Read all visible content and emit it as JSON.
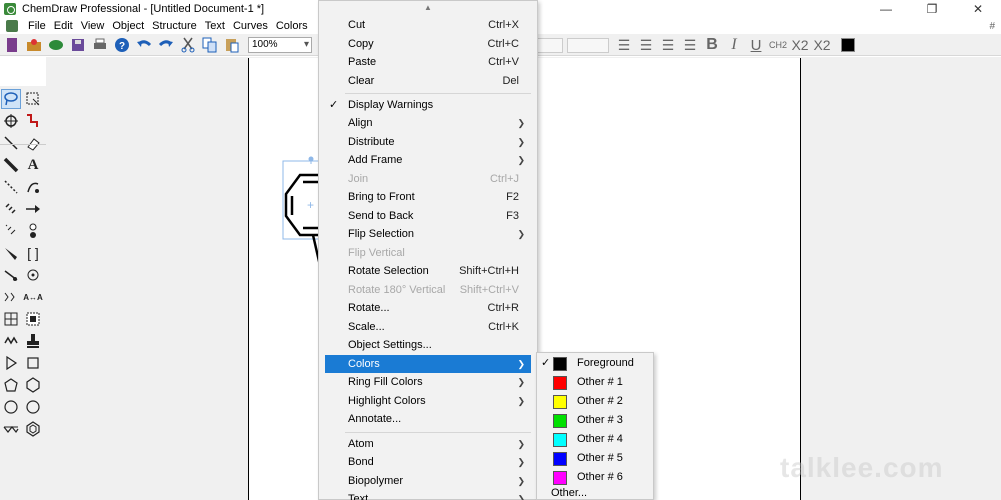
{
  "window": {
    "title": "ChemDraw Professional - [Untitled Document-1 *]",
    "controls": {
      "minimize": "—",
      "maximize": "❐",
      "close": "✕"
    }
  },
  "menubar": {
    "items": [
      "File",
      "Edit",
      "View",
      "Object",
      "Structure",
      "Text",
      "Curves",
      "Colors"
    ],
    "right_marker": "#"
  },
  "toolbar": {
    "zoom_value": "100%",
    "format_buttons": [
      "B",
      "I",
      "U",
      "CH2",
      "X2",
      "X2"
    ],
    "icons": [
      "new-document-icon",
      "open-icon",
      "online-icon",
      "save-icon",
      "print-icon",
      "help-icon",
      "undo-icon",
      "redo-icon",
      "cut-icon",
      "copy-icon",
      "paste-icon"
    ],
    "foreground_color": "#000000"
  },
  "palette": {
    "tools": [
      "lasso-tool",
      "marquee-tool",
      "chain-tool",
      "structure-perspective-tool",
      "solid-bond-tool",
      "eraser-tool",
      "bold-bond-tool",
      "text-tool",
      "dashed-bond-tool",
      "pen-tool",
      "hashed-bond-tool",
      "arrow-tool",
      "hash-wedge-tool",
      "orbital-tool",
      "wedge-bond-tool",
      "bracket-tool",
      "wavy-bond-tool",
      "chemical-symbol-tool",
      "query-tool",
      "atom-map-tool",
      "table-tool",
      "template-tool",
      "ring-tool",
      "stamp-tool",
      "triangle-ring-tool",
      "square-ring-tool",
      "pentagon-ring-tool",
      "hexagon-ring-tool",
      "circle-ring-tool",
      "cyclohexane-tool",
      "wave-ring-tool",
      "benzene-tool"
    ]
  },
  "context_menu": {
    "scroll_up": "▲",
    "items": [
      {
        "label": "Cut",
        "shortcut": "Ctrl+X"
      },
      {
        "label": "Copy",
        "shortcut": "Ctrl+C"
      },
      {
        "label": "Paste",
        "shortcut": "Ctrl+V"
      },
      {
        "label": "Clear",
        "shortcut": "Del"
      },
      {
        "label": "Display Warnings",
        "checked": true
      },
      {
        "label": "Align",
        "submenu": true
      },
      {
        "label": "Distribute",
        "submenu": true
      },
      {
        "label": "Add Frame",
        "submenu": true
      },
      {
        "label": "Join",
        "shortcut": "Ctrl+J",
        "disabled": true
      },
      {
        "label": "Bring to Front",
        "shortcut": "F2"
      },
      {
        "label": "Send to Back",
        "shortcut": "F3"
      },
      {
        "label": "Flip Selection",
        "submenu": true
      },
      {
        "label": "Flip Vertical",
        "disabled": true
      },
      {
        "label": "Rotate Selection",
        "shortcut": "Shift+Ctrl+H"
      },
      {
        "label": "Rotate 180° Vertical",
        "shortcut": "Shift+Ctrl+V",
        "disabled": true
      },
      {
        "label": "Rotate...",
        "shortcut": "Ctrl+R"
      },
      {
        "label": "Scale...",
        "shortcut": "Ctrl+K"
      },
      {
        "label": "Object Settings..."
      },
      {
        "label": "Colors",
        "submenu": true,
        "highlighted": true
      },
      {
        "label": "Ring Fill Colors",
        "submenu": true
      },
      {
        "label": "Highlight Colors",
        "submenu": true
      },
      {
        "label": "Annotate..."
      },
      {
        "label": "Atom",
        "submenu": true
      },
      {
        "label": "Bond",
        "submenu": true
      },
      {
        "label": "Biopolymer",
        "submenu": true
      },
      {
        "label": "Text",
        "submenu": true
      }
    ]
  },
  "colors_submenu": {
    "items": [
      {
        "label": "Foreground",
        "color": "#000000",
        "checked": true
      },
      {
        "label": "Other # 1",
        "color": "#ff0000"
      },
      {
        "label": "Other # 2",
        "color": "#ffff00"
      },
      {
        "label": "Other # 3",
        "color": "#00e000"
      },
      {
        "label": "Other # 4",
        "color": "#00ffff"
      },
      {
        "label": "Other # 5",
        "color": "#0000ff"
      },
      {
        "label": "Other # 6",
        "color": "#ff00ff"
      },
      {
        "label": "Other..."
      }
    ]
  },
  "watermark": "talklee.com"
}
